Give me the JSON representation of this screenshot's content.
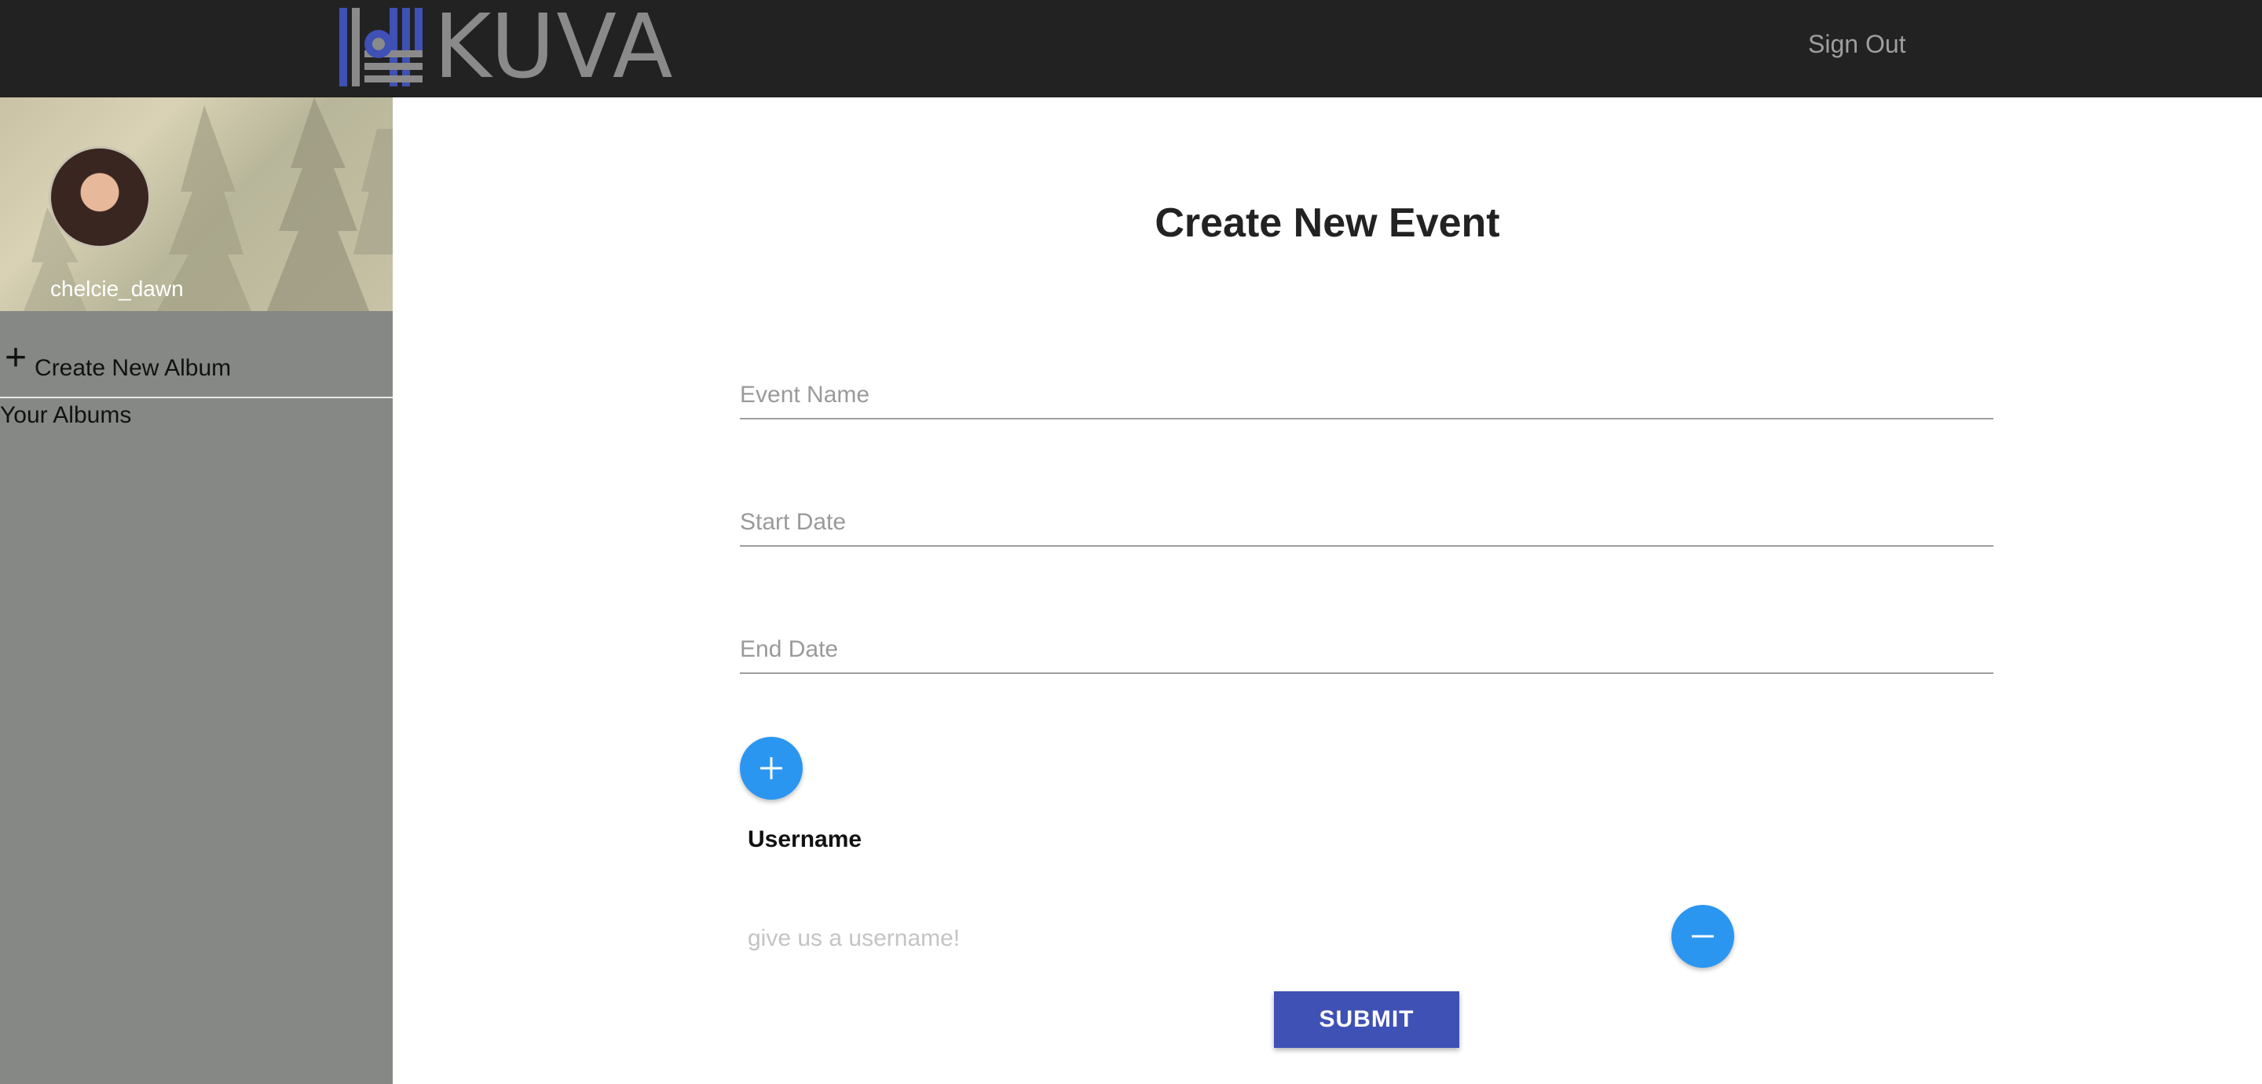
{
  "header": {
    "brand": "KUVA",
    "sign_out_label": "Sign Out"
  },
  "sidebar": {
    "username": "chelcie_dawn",
    "create_album_label": "Create New Album",
    "your_albums_label": "Your Albums"
  },
  "form": {
    "title": "Create New Event",
    "event_name_placeholder": "Event Name",
    "start_date_placeholder": "Start Date",
    "end_date_placeholder": "End Date",
    "username_label": "Username",
    "username_placeholder": "give us a username!",
    "submit_label": "SUBMIT"
  },
  "colors": {
    "topbar": "#222222",
    "sidebar": "#858885",
    "accent_button": "#2b96f0",
    "submit_button": "#3f51b5",
    "logo_mark": "#3f51b5"
  },
  "icons": {
    "logo": "kuva-logo-icon",
    "add": "plus-icon",
    "remove": "minus-icon"
  }
}
